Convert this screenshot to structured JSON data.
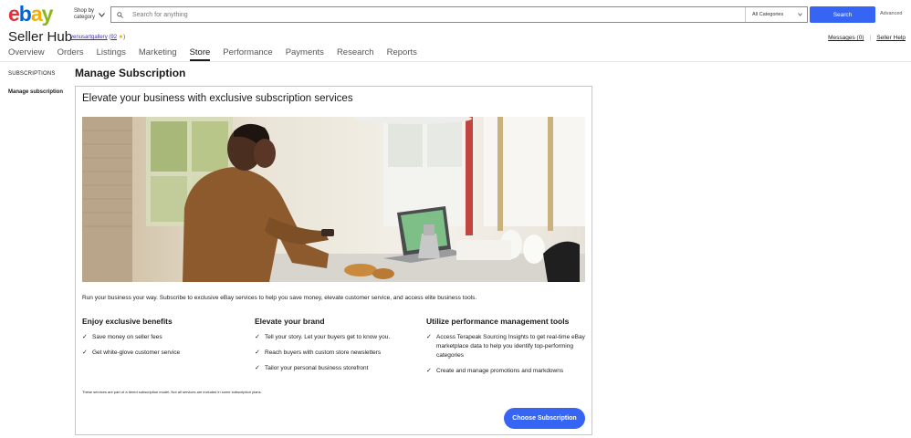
{
  "header": {
    "logo_letters": [
      "e",
      "b",
      "a",
      "y"
    ],
    "shop_by": [
      "Shop by",
      "category"
    ],
    "search_placeholder": "Search for anything",
    "category": "All Categories",
    "search_button": "Search",
    "advanced": "Advanced"
  },
  "hub": {
    "title": "Seller Hub",
    "username": "venusartgallery",
    "feedback_open": "(",
    "feedback": "92",
    "star": "★",
    "feedback_close": ")",
    "messages": "Messages (0)",
    "separator": "|",
    "help": "Seller Help"
  },
  "nav": {
    "tabs": [
      "Overview",
      "Orders",
      "Listings",
      "Marketing",
      "Store",
      "Performance",
      "Payments",
      "Research",
      "Reports"
    ],
    "active": "Store"
  },
  "sidebar": {
    "section": "SUBSCRIPTIONS",
    "item": "Manage subscription"
  },
  "main": {
    "page_title": "Manage Subscription",
    "card_title": "Elevate your business with exclusive subscription services",
    "intro": "Run your business your way. Subscribe to exclusive eBay services to help you save money, elevate customer service, and access elite business tools.",
    "columns": [
      {
        "title": "Enjoy exclusive benefits",
        "items": [
          "Save money on seller fees",
          "Get white-glove customer service"
        ]
      },
      {
        "title": "Elevate your brand",
        "items": [
          "Tell your story. Let your buyers get to know you.",
          "Reach buyers with custom store newsletters",
          "Tailor your personal business storefront"
        ]
      },
      {
        "title": "Utilize performance management tools",
        "items": [
          "Access Terapeak Sourcing Insights to get real-time eBay marketplace data to help you identify top-performing categories",
          "Create and manage promotions and markdowns"
        ]
      }
    ],
    "footnote": "These services are part of a tiered subscription model. Not all services are included in some subscription plans.",
    "cta": "Choose Subscription"
  },
  "colors": {
    "accent": "#3665f3",
    "logo": [
      "#e53238",
      "#0064d2",
      "#f5af02",
      "#86b817"
    ]
  }
}
